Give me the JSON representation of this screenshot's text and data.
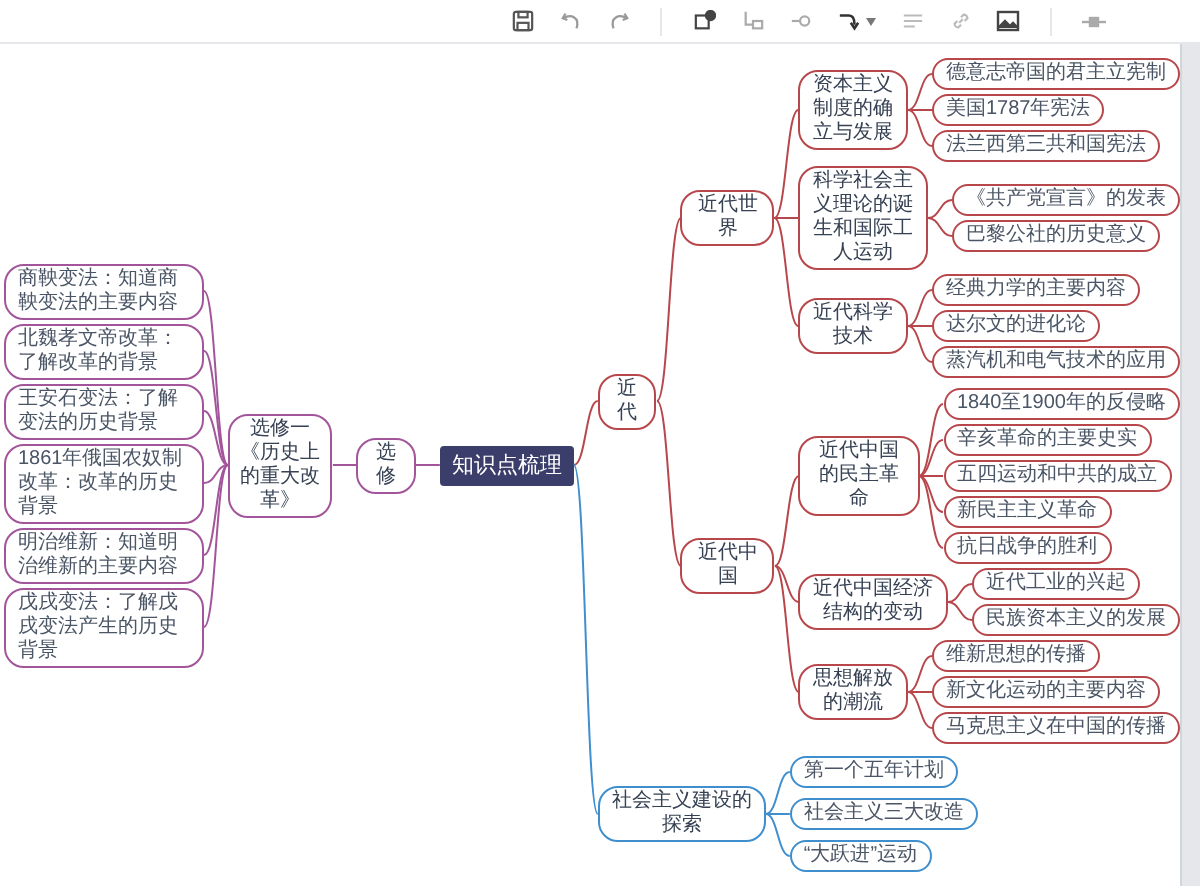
{
  "root": "知识点梳理",
  "left": [
    {
      "label": "选修",
      "color": "#a3559b",
      "children": [
        {
          "label": "选修一《历史上的重大改革》",
          "children": [
            {
              "label": "商鞅变法：知道商鞅变法的主要内容"
            },
            {
              "label": "北魏孝文帝改革：了解改革的背景"
            },
            {
              "label": "王安石变法：了解变法的历史背景"
            },
            {
              "label": "1861年俄国农奴制改革：改革的历史背景"
            },
            {
              "label": "明治维新：知道明治维新的主要内容"
            },
            {
              "label": "戊戌变法：了解戊戌变法产生的历史背景"
            }
          ]
        }
      ]
    }
  ],
  "right": [
    {
      "label": "近代",
      "color": "#b8474c",
      "children": [
        {
          "label": "近代世界",
          "children": [
            {
              "label": "资本主义制度的确立与发展",
              "children": [
                {
                  "label": "德意志帝国的君主立宪制"
                },
                {
                  "label": "美国1787年宪法"
                },
                {
                  "label": "法兰西第三共和国宪法"
                }
              ]
            },
            {
              "label": "科学社会主义理论的诞生和国际工人运动",
              "children": [
                {
                  "label": "《共产党宣言》的发表"
                },
                {
                  "label": "巴黎公社的历史意义"
                }
              ]
            },
            {
              "label": "近代科学技术",
              "children": [
                {
                  "label": "经典力学的主要内容"
                },
                {
                  "label": "达尔文的进化论"
                },
                {
                  "label": "蒸汽机和电气技术的应用"
                }
              ]
            }
          ]
        },
        {
          "label": "近代中国",
          "children": [
            {
              "label": "近代中国的民主革命",
              "children": [
                {
                  "label": "1840至1900年的反侵略"
                },
                {
                  "label": "辛亥革命的主要史实"
                },
                {
                  "label": "五四运动和中共的成立"
                },
                {
                  "label": "新民主主义革命"
                },
                {
                  "label": "抗日战争的胜利"
                }
              ]
            },
            {
              "label": "近代中国经济结构的变动",
              "children": [
                {
                  "label": "近代工业的兴起"
                },
                {
                  "label": "民族资本主义的发展"
                }
              ]
            },
            {
              "label": "思想解放的潮流",
              "children": [
                {
                  "label": "维新思想的传播"
                },
                {
                  "label": "新文化运动的主要内容"
                },
                {
                  "label": "马克思主义在中国的传播"
                }
              ]
            }
          ]
        }
      ]
    },
    {
      "label": "社会主义建设的探索",
      "color": "#3f8fcf",
      "children": [
        {
          "label": "第一个五年计划"
        },
        {
          "label": "社会主义三大改造"
        },
        {
          "label": "“大跃进”运动"
        }
      ]
    }
  ]
}
